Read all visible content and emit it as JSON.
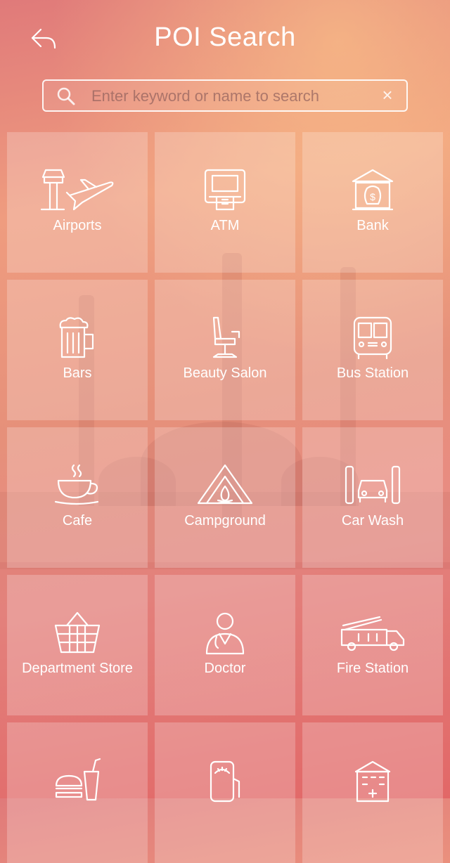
{
  "header": {
    "title": "POI Search"
  },
  "search": {
    "placeholder": "Enter keyword or name to search",
    "value": "",
    "clear_label": "×"
  },
  "categories": [
    {
      "label": "Airports",
      "icon": "airport-icon"
    },
    {
      "label": "ATM",
      "icon": "atm-icon"
    },
    {
      "label": "Bank",
      "icon": "bank-icon"
    },
    {
      "label": "Bars",
      "icon": "beer-mug-icon"
    },
    {
      "label": "Beauty Salon",
      "icon": "salon-chair-icon"
    },
    {
      "label": "Bus Station",
      "icon": "bus-icon"
    },
    {
      "label": "Cafe",
      "icon": "coffee-cup-icon"
    },
    {
      "label": "Campground",
      "icon": "tent-icon"
    },
    {
      "label": "Car Wash",
      "icon": "car-wash-icon"
    },
    {
      "label": "Department Store",
      "icon": "shopping-basket-icon"
    },
    {
      "label": "Doctor",
      "icon": "doctor-icon"
    },
    {
      "label": "Fire Station",
      "icon": "fire-truck-icon"
    },
    {
      "label": "",
      "icon": "fast-food-icon"
    },
    {
      "label": "",
      "icon": "gas-pump-icon"
    },
    {
      "label": "",
      "icon": "hospital-icon"
    }
  ]
}
